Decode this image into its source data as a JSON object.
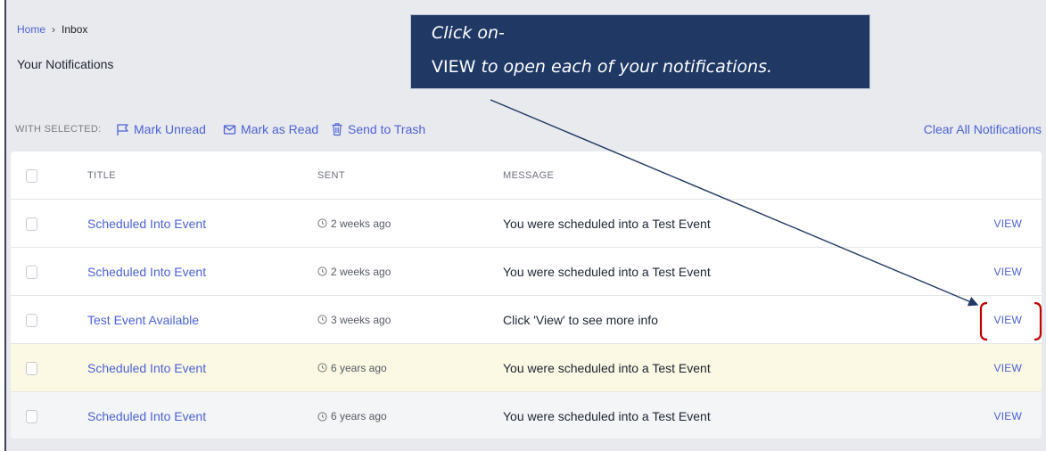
{
  "breadcrumb": {
    "home": "Home",
    "separator": "›",
    "current": "Inbox"
  },
  "page_title": "Your Notifications",
  "toolbar": {
    "with_selected": "WITH SELECTED:",
    "mark_unread": "Mark Unread",
    "mark_read": "Mark as Read",
    "send_trash": "Send to Trash",
    "clear_all": "Clear All Notifications"
  },
  "table": {
    "headers": {
      "title": "TITLE",
      "sent": "SENT",
      "message": "MESSAGE"
    },
    "rows": [
      {
        "title": "Scheduled Into Event",
        "sent": "2 weeks ago",
        "message": "You were scheduled into a Test Event",
        "action": "VIEW"
      },
      {
        "title": "Scheduled Into Event",
        "sent": "2 weeks ago",
        "message": "You were scheduled into a Test Event",
        "action": "VIEW"
      },
      {
        "title": "Test Event Available",
        "sent": "3 weeks ago",
        "message": "Click 'View' to see more info",
        "action": "VIEW"
      },
      {
        "title": "Scheduled Into Event",
        "sent": "6 years ago",
        "message": "You were scheduled into a Test Event",
        "action": "VIEW"
      },
      {
        "title": "Scheduled Into Event",
        "sent": "6 years ago",
        "message": "You were scheduled into a Test Event",
        "action": "VIEW"
      }
    ]
  },
  "callout": {
    "line1": "Click on-",
    "keyword": "VIEW",
    "line2": " to open each of your notifications."
  },
  "colors": {
    "accent": "#4b62d4",
    "callout_bg": "#1f3864",
    "highlight_row": "#fbf9e3",
    "bracket": "#c00000"
  },
  "icons": {
    "mark_unread": "flag-icon",
    "mark_read": "envelope-icon",
    "send_trash": "trash-icon",
    "sent": "clock-icon"
  }
}
